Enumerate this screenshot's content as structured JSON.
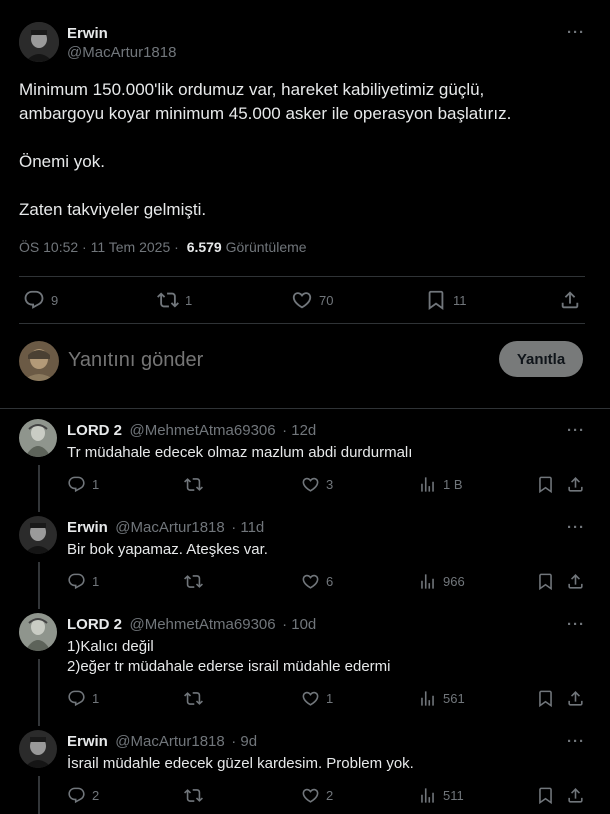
{
  "main_tweet": {
    "author_name": "Erwin",
    "author_handle": "@MacArtur1818",
    "text_line1": "Minimum 150.000'lik ordumuz var, hareket kabiliyetimiz güçlü,",
    "text_line2": "ambargoyu koyar minimum 45.000 asker ile operasyon başlatırız.",
    "text_para2": "Önemi yok.",
    "text_para3": "Zaten takviyeler gelmişti.",
    "time": "ÖS 10:52 · 11 Tem 2025 ·",
    "views_count": "6.579",
    "views_label": "Görüntüleme",
    "replies": "9",
    "reposts": "1",
    "likes": "70",
    "bookmarks": "11"
  },
  "compose": {
    "placeholder": "Yanıtını gönder",
    "button_label": "Yanıtla"
  },
  "replies": [
    {
      "name": "LORD 2",
      "handle": "@MehmetAtma69306",
      "time": "· 12d",
      "text": [
        "Tr müdahale edecek olmaz mazlum abdi durdurmalı"
      ],
      "replies": "1",
      "reposts": "",
      "likes": "3",
      "views": "1 B"
    },
    {
      "name": "Erwin",
      "handle": "@MacArtur1818",
      "time": "· 11d",
      "text": [
        "Bir bok yapamaz. Ateşkes var."
      ],
      "replies": "1",
      "reposts": "",
      "likes": "6",
      "views": "966"
    },
    {
      "name": "LORD 2",
      "handle": "@MehmetAtma69306",
      "time": "· 10d",
      "text": [
        "1)Kalıcı değil",
        "2)eğer tr müdahale ederse israil müdahle edermi"
      ],
      "replies": "1",
      "reposts": "",
      "likes": "1",
      "views": "561"
    },
    {
      "name": "Erwin",
      "handle": "@MacArtur1818",
      "time": "· 9d",
      "text": [
        "İsrail müdahle edecek güzel kardesim. Problem yok."
      ],
      "replies": "2",
      "reposts": "",
      "likes": "2",
      "views": "511"
    }
  ],
  "colors": {
    "background": "#000000",
    "text": "#e7e9ea",
    "muted": "#71767b",
    "border": "#2f3336",
    "reply_button": "#787a7a"
  }
}
